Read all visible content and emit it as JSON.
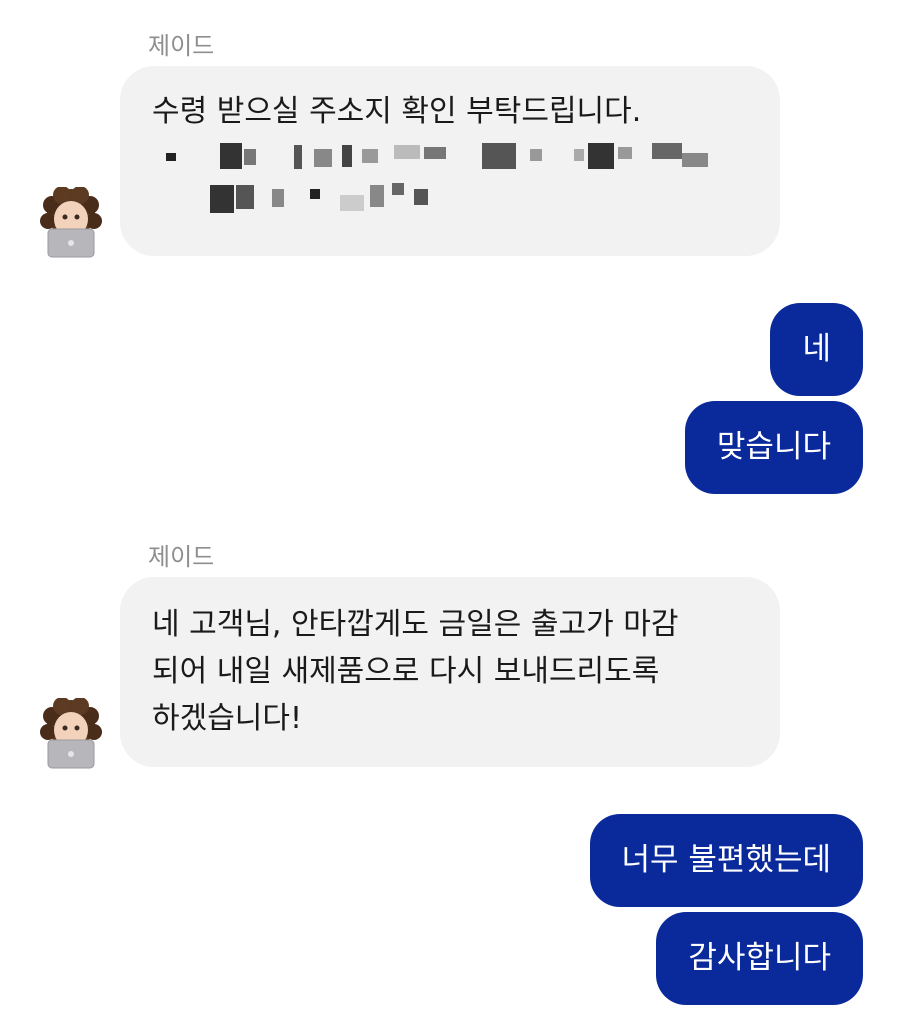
{
  "messages": [
    {
      "sender": "제이드",
      "text": "수령 받으실 주소지 확인 부탁드립니다."
    },
    {
      "text": "네"
    },
    {
      "text": "맞습니다"
    },
    {
      "sender": "제이드",
      "lines": [
        "네 고객님, 안타깝게도 금일은 출고가 마감",
        "되어 내일 새제품으로 다시 보내드리도록",
        "하겠습니다!"
      ]
    },
    {
      "text": "너무 불편했는데"
    },
    {
      "text": "감사합니다"
    }
  ],
  "colors": {
    "incoming_bg": "#f2f2f2",
    "outgoing_bg": "#0a2a9c",
    "sender_text": "#8e8e8e"
  }
}
